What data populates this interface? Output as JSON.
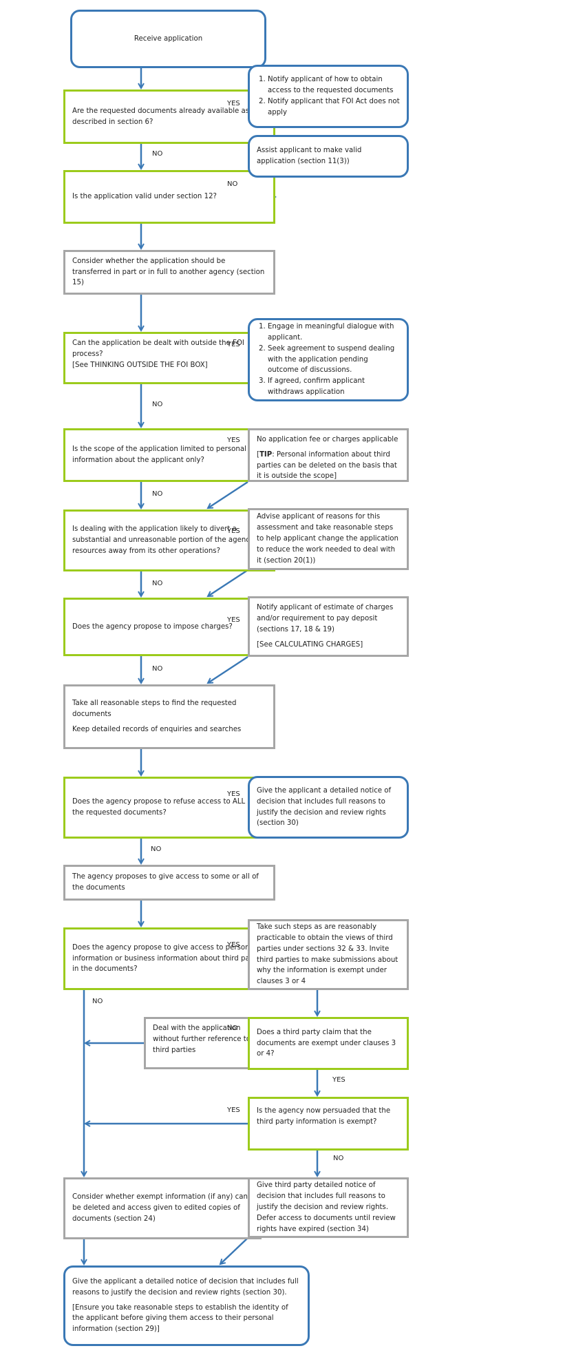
{
  "colors": {
    "decision": "#9ccb1c",
    "process": "#a6a6a6",
    "terminal": "#3a78b5",
    "arrow": "#3a78b5"
  },
  "labels": {
    "yes": "YES",
    "no": "NO"
  },
  "nodes": {
    "start": "Receive application",
    "q1": "Are the requested documents already available as described in section 6?",
    "r1": [
      "Notify applicant of how to obtain access to the requested documents",
      "Notify applicant that FOI Act does not apply"
    ],
    "q2": "Is the application valid under section 12?",
    "r2": "Assist applicant to make valid application (section 11(3))",
    "p1": "Consider whether the application should be transferred in part or in full to another agency (section 15)",
    "q3": {
      "line1": "Can the application be dealt with outside the FOI process?",
      "line2": "[See THINKING OUTSIDE THE FOI BOX]"
    },
    "r3": [
      "Engage in meaningful dialogue with applicant.",
      "Seek agreement to suspend dealing with  the application pending outcome of discussions.",
      "If agreed, confirm applicant withdraws application"
    ],
    "q4": "Is the scope of the application limited to personal information about the applicant only?",
    "r4": {
      "line1": "No application fee or charges applicable",
      "tip_label": "TIP",
      "tip_text": ": Personal information about third parties can be deleted on the basis that it is outside the scope]"
    },
    "q5": "Is dealing with the application likely to divert a substantial and unreasonable portion of the agency's resources away from its other operations?",
    "r5": "Advise applicant of reasons for this assessment and take reasonable steps to help applicant change the application to reduce the work needed to deal with it (section 20(1))",
    "q6": "Does the agency propose to impose charges?",
    "r6": {
      "line1": "Notify applicant of estimate of charges and/or requirement to pay deposit (sections 17, 18 & 19)",
      "line2": "[See CALCULATING CHARGES]"
    },
    "p2": {
      "line1": "Take all reasonable steps to find the requested documents",
      "line2": "Keep detailed records of enquiries and searches"
    },
    "q7": "Does the agency propose to refuse access to ALL of the requested documents?",
    "r7": "Give the applicant a detailed notice of decision that includes full reasons to justify the decision and review rights (section 30)",
    "p3": "The agency proposes to give access  to some or all of the documents",
    "q8": "Does the agency propose to give access to personal information or business information about third parties in the documents?",
    "r8": "Take such steps as are reasonably practicable to obtain the views of third parties under sections 32 & 33. Invite third parties to make submissions about why the information is exempt under clauses 3 or 4",
    "q9": "Does a third party claim that the documents are exempt under clauses 3 or 4?",
    "p4": "Deal with the application without further reference to third parties",
    "q10": "Is the agency now persuaded that the third party information is exempt?",
    "p5": "Consider whether exempt information (if any) can be deleted and access given to edited copies of documents (section 24)",
    "p6": "Give third party detailed notice of decision that includes full reasons to justify the decision and review rights. Defer access to documents until review rights have expired (section 34)",
    "end": {
      "line1": "Give the applicant a detailed notice of decision that includes full reasons to justify the decision and review rights (section 30).",
      "line2": "[Ensure you take reasonable steps to establish the identity of the applicant before giving them access to their personal information (section 29)]"
    }
  }
}
